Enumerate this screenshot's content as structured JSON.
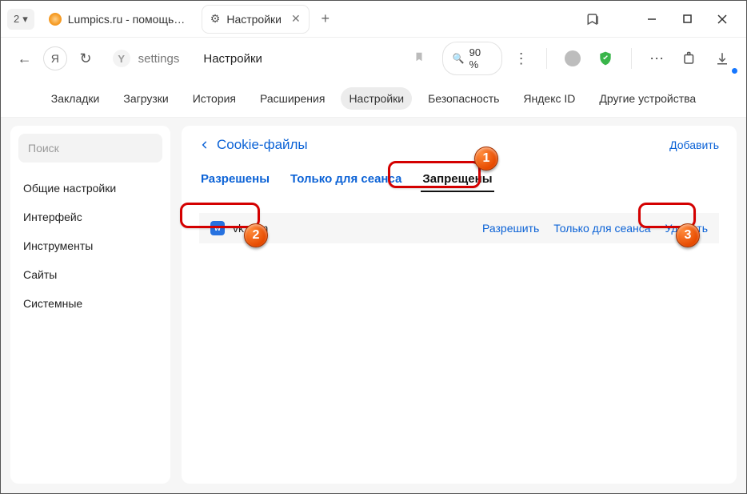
{
  "titlebar": {
    "tab_count": "2",
    "tabs": [
      {
        "title": "Lumpics.ru - помощь с ко",
        "favicon_color": "#f59a23"
      },
      {
        "title": "Настройки",
        "favicon_glyph": "⚙"
      }
    ],
    "new_tab_glyph": "+"
  },
  "addressbar": {
    "back_glyph": "←",
    "yandex_glyph": "Я",
    "reload_glyph": "↻",
    "site_icon_glyph": "Y",
    "url_text": "settings",
    "page_title": "Настройки",
    "bookmark_glyph": "🔖",
    "zoom_glyph": "🔍",
    "zoom_value": "90 %",
    "menu_dots": "⋮",
    "more_dots": "⋯"
  },
  "navtabs": {
    "items": [
      "Закладки",
      "Загрузки",
      "История",
      "Расширения",
      "Настройки",
      "Безопасность",
      "Яндекс ID",
      "Другие устройства"
    ],
    "active_index": 4
  },
  "sidebar": {
    "search_placeholder": "Поиск",
    "items": [
      "Общие настройки",
      "Интерфейс",
      "Инструменты",
      "Сайты",
      "Системные"
    ]
  },
  "main": {
    "breadcrumb": "Cookie-файлы",
    "add_label": "Добавить",
    "tabs": [
      "Разрешены",
      "Только для сеанса",
      "Запрещены"
    ],
    "active_tab_index": 2,
    "site": {
      "favicon_letter": "w",
      "domain": "vk.com",
      "actions": [
        "Разрешить",
        "Только для сеанса",
        "Удалить"
      ]
    }
  },
  "annotations": {
    "b1": "1",
    "b2": "2",
    "b3": "3"
  }
}
